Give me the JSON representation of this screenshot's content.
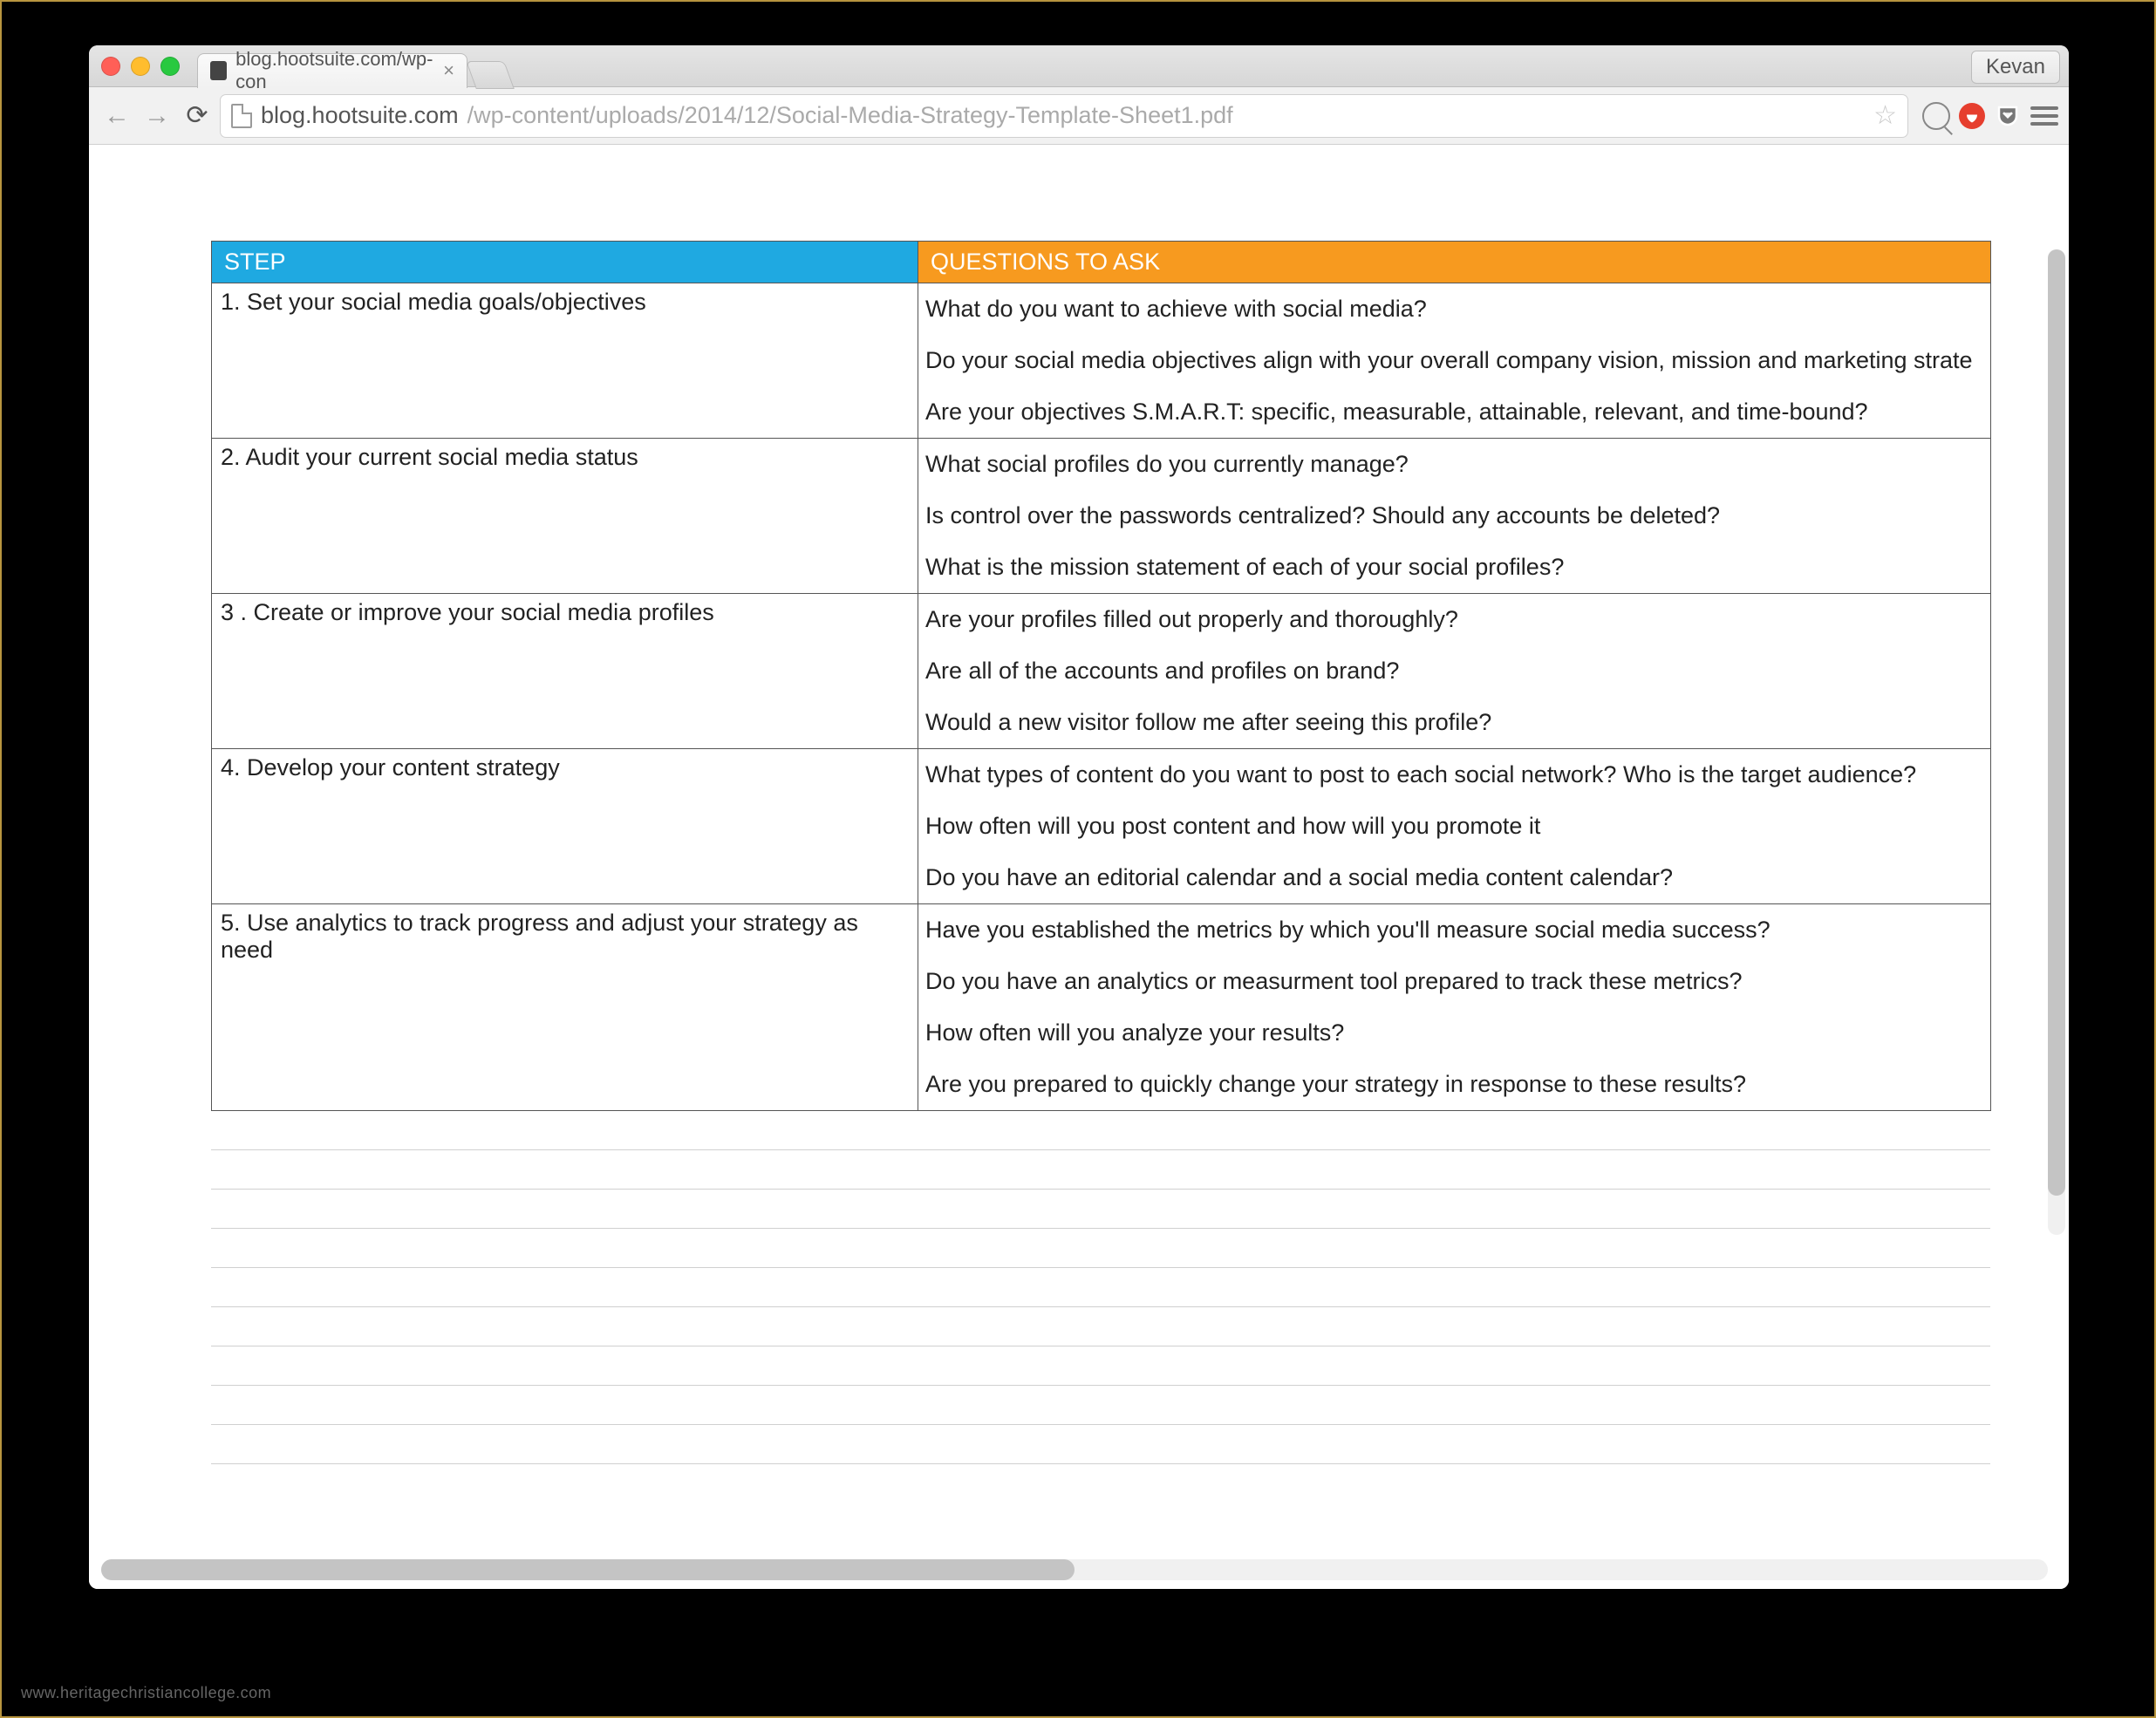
{
  "window": {
    "user": "Kevan"
  },
  "tab": {
    "title": "blog.hootsuite.com/wp-con"
  },
  "url": {
    "host": "blog.hootsuite.com",
    "path": "/wp-content/uploads/2014/12/Social-Media-Strategy-Template-Sheet1.pdf"
  },
  "headers": {
    "step": "STEP",
    "questions": "QUESTIONS TO ASK"
  },
  "rows": [
    {
      "step": "1. Set your social media goals/objectives",
      "questions": [
        "What do you want to achieve with social media?",
        "Do your social media objectives align with your overall company vision, mission and marketing strate",
        "Are your objectives S.M.A.R.T: specific, measurable, attainable, relevant, and time-bound?"
      ]
    },
    {
      "step": "2. Audit your current social media status",
      "questions": [
        "What social profiles do you currently manage?",
        "Is control over the passwords centralized? Should any accounts be deleted?",
        "What is the mission statement of each of your social profiles?"
      ]
    },
    {
      "step": "3 . Create or improve your social media profiles",
      "questions": [
        "Are your profiles filled out properly and thoroughly?",
        "Are all of the accounts and profiles on brand?",
        "Would a new visitor follow me after seeing this profile?"
      ]
    },
    {
      "step": "4. Develop your content strategy",
      "questions": [
        "What types of content do you want to post to each social network? Who is the target audience?",
        "How often will you post content and how will you promote it",
        "Do you have an editorial calendar and a social media content calendar?"
      ]
    },
    {
      "step": "5. Use analytics to track progress and adjust your strategy as need",
      "questions": [
        "Have you established the metrics by which you'll measure social media success?",
        "Do you have an analytics or measurment tool prepared to track these metrics?",
        "How often will you analyze your results?",
        "Are you prepared to quickly change your strategy in response to these results?"
      ]
    }
  ],
  "watermark": "www.heritagechristiancollege.com"
}
